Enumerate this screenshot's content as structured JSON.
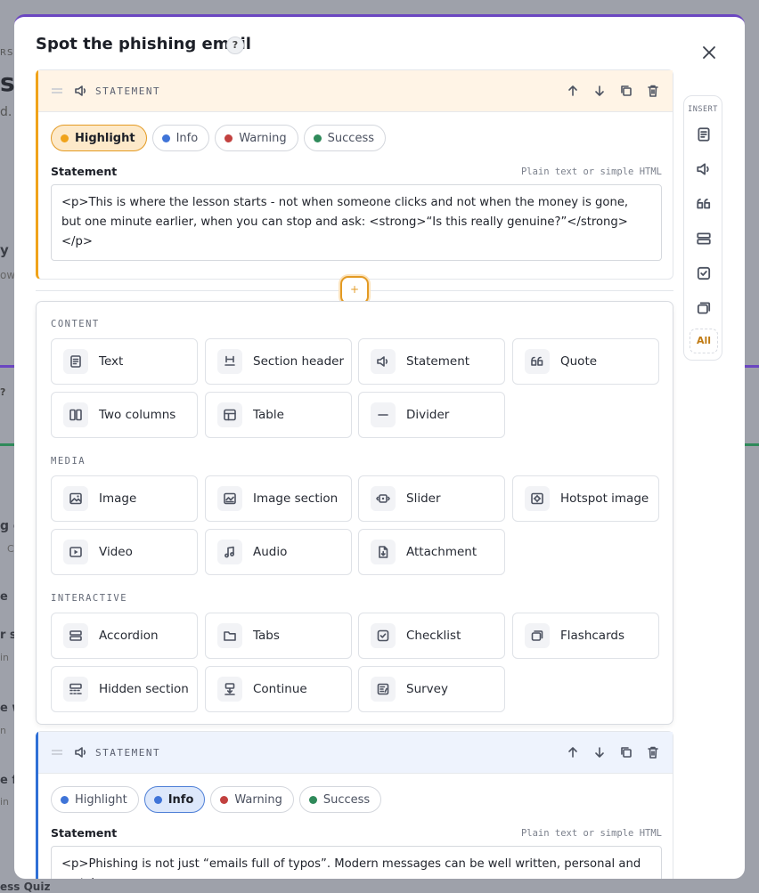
{
  "modal": {
    "title": "Spot the phishing email",
    "help": "?"
  },
  "blocks": [
    {
      "type_label": "STATEMENT",
      "variants": [
        "Highlight",
        "Info",
        "Warning",
        "Success"
      ],
      "selected_variant": "Highlight",
      "field_label": "Statement",
      "field_hint": "Plain text or simple HTML",
      "value": "<p>This is where the lesson starts - not when someone clicks and not when the money is gone, but one minute earlier, when you can stop and ask: <strong>“Is this really genuine?”</strong></p>"
    },
    {
      "type_label": "STATEMENT",
      "variants": [
        "Highlight",
        "Info",
        "Warning",
        "Success"
      ],
      "selected_variant": "Info",
      "field_label": "Statement",
      "field_hint": "Plain text or simple HTML",
      "value": "<p>Phishing is not just “emails full of typos”. Modern messages can be well written, personal and match"
    }
  ],
  "variant_colors": {
    "Highlight": "#f0a31a",
    "Info": "#3f74d8",
    "Warning": "#c2413f",
    "Success": "#2f8a5a"
  },
  "insert_button": "+",
  "picker": {
    "categories": [
      {
        "label": "CONTENT",
        "items": [
          {
            "label": "Text",
            "icon": "text-icon"
          },
          {
            "label": "Section header",
            "icon": "heading-icon"
          },
          {
            "label": "Statement",
            "icon": "speaker-icon"
          },
          {
            "label": "Quote",
            "icon": "quote-icon"
          },
          {
            "label": "Two columns",
            "icon": "columns-icon"
          },
          {
            "label": "Table",
            "icon": "table-icon"
          },
          {
            "label": "Divider",
            "icon": "divider-icon"
          }
        ]
      },
      {
        "label": "MEDIA",
        "items": [
          {
            "label": "Image",
            "icon": "image-icon"
          },
          {
            "label": "Image section",
            "icon": "image-section-icon"
          },
          {
            "label": "Slider",
            "icon": "slider-icon"
          },
          {
            "label": "Hotspot image",
            "icon": "hotspot-icon"
          },
          {
            "label": "Video",
            "icon": "video-icon"
          },
          {
            "label": "Audio",
            "icon": "audio-icon"
          },
          {
            "label": "Attachment",
            "icon": "attachment-icon"
          }
        ]
      },
      {
        "label": "INTERACTIVE",
        "items": [
          {
            "label": "Accordion",
            "icon": "accordion-icon"
          },
          {
            "label": "Tabs",
            "icon": "tabs-icon"
          },
          {
            "label": "Checklist",
            "icon": "checklist-icon"
          },
          {
            "label": "Flashcards",
            "icon": "flashcards-icon"
          },
          {
            "label": "Hidden section",
            "icon": "hidden-section-icon"
          },
          {
            "label": "Continue",
            "icon": "continue-icon"
          },
          {
            "label": "Survey",
            "icon": "survey-icon"
          }
        ]
      }
    ]
  },
  "insert_rail": {
    "title": "INSERT",
    "icons": [
      "text-icon",
      "speaker-icon",
      "quote-icon",
      "accordion-icon",
      "checklist-icon",
      "flashcards-icon"
    ],
    "all_label": "All"
  },
  "background": {
    "fragments": [
      "RS",
      "s f",
      "d.",
      "y h",
      "own",
      "?",
      "g e",
      "C",
      "e",
      "r su",
      "in",
      "e w",
      "n",
      "e f",
      "in",
      "ess Quiz"
    ]
  }
}
